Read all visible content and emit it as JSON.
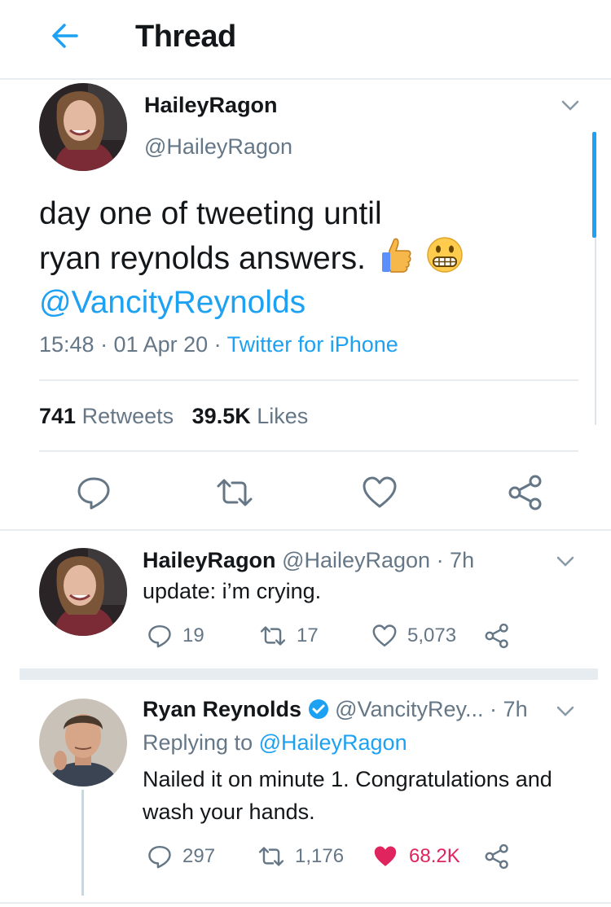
{
  "header": {
    "title": "Thread"
  },
  "main_tweet": {
    "author": "HaileyRagon",
    "handle": "@HaileyRagon",
    "text_line1": "day one of tweeting until",
    "text_line2": "ryan reynolds answers.",
    "mention": "@VancityReynolds",
    "time": "15:48 · 01 Apr 20 · ",
    "source": "Twitter for iPhone",
    "retweets_count": "741",
    "retweets_label": "Retweets",
    "likes_count": "39.5K",
    "likes_label": "Likes"
  },
  "reply1": {
    "author": "HaileyRagon",
    "handle_time": "@HaileyRagon · 7h",
    "text": "update: i’m crying.",
    "replies": "19",
    "retweets": "17",
    "likes": "5,073"
  },
  "reply2": {
    "author": "Ryan Reynolds",
    "handle_time": "@VancityRey... · 7h",
    "replying_prefix": "Replying to ",
    "replying_to": "@HaileyRagon",
    "text": "Nailed it on minute 1. Congratulations and wash your hands.",
    "replies": "297",
    "retweets": "1,176",
    "likes": "68.2K"
  },
  "colors": {
    "accent": "#1da1f2",
    "liked": "#e0245e",
    "muted": "#657786",
    "text": "#14171a"
  }
}
